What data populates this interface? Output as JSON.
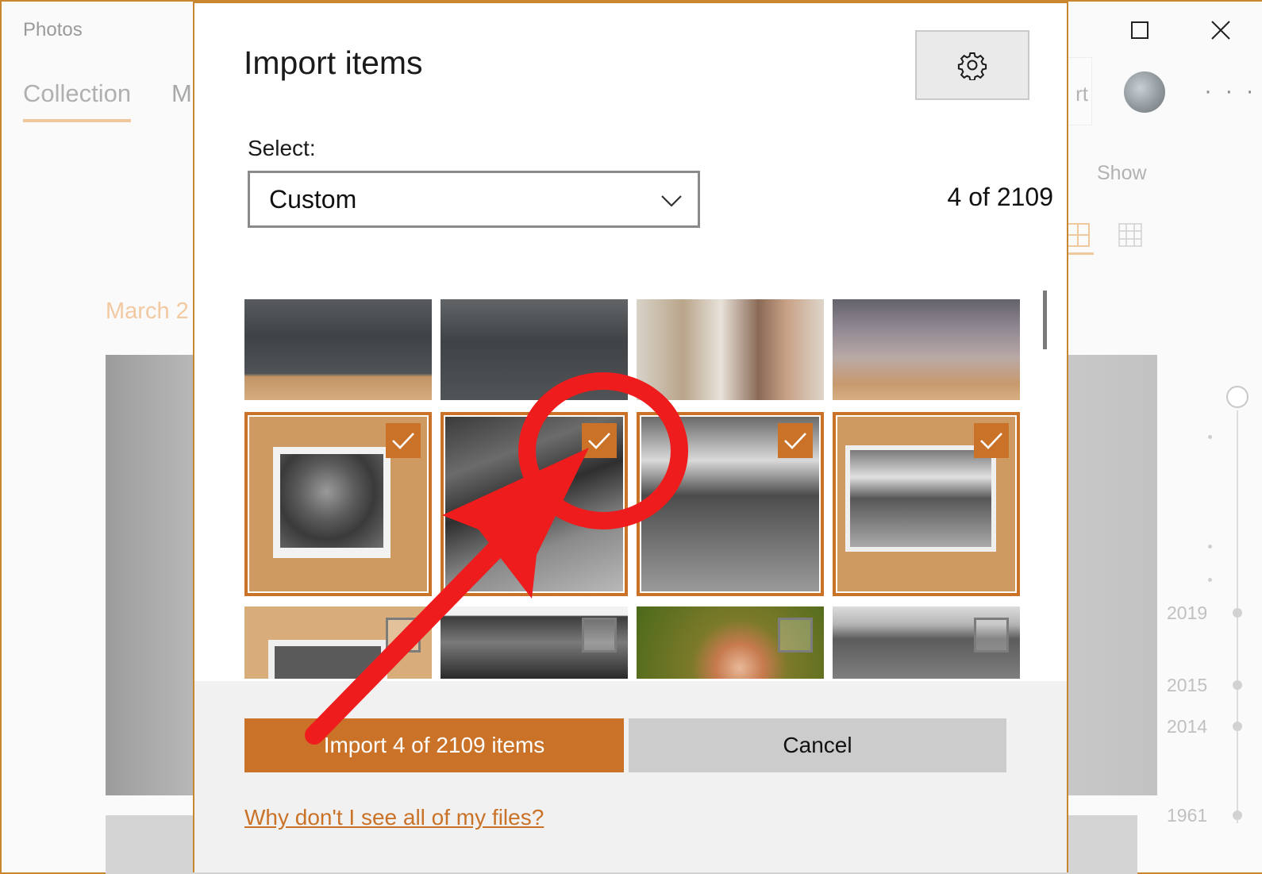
{
  "app": {
    "title": "Photos",
    "tabs": [
      {
        "label": "Collection",
        "selected": true
      },
      {
        "label": "M"
      }
    ],
    "import_fragment": "rt",
    "more_label": "· · ·",
    "show_label": "Show",
    "date_heading": "March 2",
    "timeline_years": [
      "2019",
      "2015",
      "2014",
      "1961"
    ],
    "window_controls": [
      "minimize-icon",
      "maximize-icon",
      "close-icon"
    ]
  },
  "dialog": {
    "title": "Import items",
    "settings_icon": "gear-icon",
    "select": {
      "label": "Select:",
      "value": "Custom",
      "icon": "chevron-down-icon"
    },
    "count": "4 of 2109",
    "tiles": [
      {
        "selected": false,
        "desc": "garden-photo"
      },
      {
        "selected": false,
        "desc": "garden-photo"
      },
      {
        "selected": false,
        "desc": "color-group-photo"
      },
      {
        "selected": false,
        "desc": "color-kids-photo"
      },
      {
        "selected": true,
        "desc": "portrait-photo"
      },
      {
        "selected": true,
        "desc": "foliage-photo"
      },
      {
        "selected": true,
        "desc": "car-street-photo"
      },
      {
        "selected": true,
        "desc": "car-street-print"
      },
      {
        "selected": false,
        "desc": "print-photo"
      },
      {
        "selected": false,
        "desc": "trees-photo"
      },
      {
        "selected": false,
        "desc": "redhead-photo"
      },
      {
        "selected": false,
        "desc": "gray-photo"
      }
    ],
    "import_button": "Import 4 of 2109 items",
    "cancel_button": "Cancel",
    "help_link": "Why don't I see all of my files?"
  },
  "colors": {
    "accent": "#c97228",
    "annotation": "#ee1c1c"
  }
}
